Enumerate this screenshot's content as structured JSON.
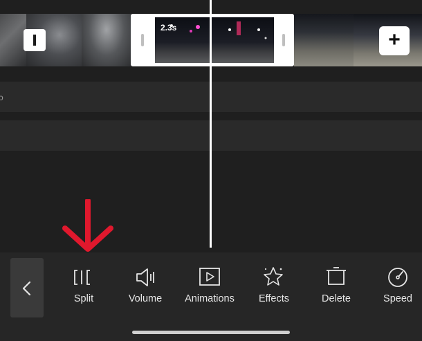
{
  "timeline": {
    "selected_clip_duration": "2.3s",
    "track_label": "o",
    "add_button": "+"
  },
  "toolbar": {
    "back": "back",
    "tools": [
      {
        "label": "Split",
        "icon": "split-icon"
      },
      {
        "label": "Volume",
        "icon": "volume-icon"
      },
      {
        "label": "Animations",
        "icon": "animations-icon"
      },
      {
        "label": "Effects",
        "icon": "effects-icon"
      },
      {
        "label": "Delete",
        "icon": "delete-icon"
      },
      {
        "label": "Speed",
        "icon": "speed-icon"
      }
    ]
  },
  "colors": {
    "background": "#1b1b1b",
    "toolbar": "#262626",
    "accent_arrow": "#e0182d",
    "selection": "#ffffff"
  }
}
